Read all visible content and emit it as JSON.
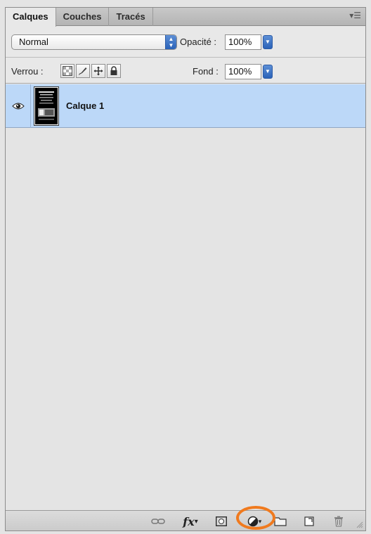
{
  "tabs": [
    {
      "label": "Calques",
      "active": true
    },
    {
      "label": "Couches",
      "active": false
    },
    {
      "label": "Tracés",
      "active": false
    }
  ],
  "panel_menu_icon": "panel-menu-icon",
  "blend": {
    "mode": "Normal",
    "opacity_label": "Opacité :",
    "opacity_value": "100%"
  },
  "lock": {
    "label": "Verrou :",
    "icons": [
      "lock-transparency-icon",
      "lock-pixels-icon",
      "lock-position-icon",
      "lock-all-icon"
    ],
    "fill_label": "Fond :",
    "fill_value": "100%"
  },
  "layers": [
    {
      "name": "Calque 1",
      "visible": true,
      "selected": true
    }
  ],
  "footer_icons": [
    "link-layers-icon",
    "layer-style-fx-icon",
    "layer-mask-icon",
    "adjustment-layer-icon",
    "group-folder-icon",
    "new-layer-icon",
    "trash-icon"
  ],
  "fx_text": "fx",
  "colors": {
    "selected_row": "#bcd8f8",
    "accent_blue": "#2a62b8",
    "highlight_ring": "#f07a1e"
  }
}
